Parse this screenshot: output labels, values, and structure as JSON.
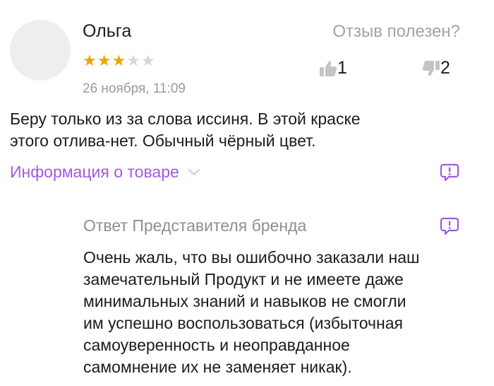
{
  "review": {
    "author": "Ольга",
    "rating": 3,
    "rating_max": 5,
    "date": "26 ноября, 11:09",
    "text_lines": [
      "Беру только из за слова иссиня. В этой краске",
      "этого отлива-нет. Обычный чёрный цвет."
    ],
    "product_info_link": "Информация о товаре"
  },
  "helpful": {
    "question": "Отзыв полезен?",
    "likes": "1",
    "dislikes": "2"
  },
  "brand_reply": {
    "title": "Ответ Представителя бренда",
    "text_lines": [
      "Очень жаль, что вы ошибочно заказали наш",
      "замечательный Продукт и не имеете даже",
      "минимальных знаний и навыков не смогли",
      "им успешно воспользоваться (избыточная",
      "самоуверенность и неоправданное",
      "самомнение их не заменяет никак)."
    ]
  },
  "icons": {
    "thumb_up": "thumbs-up-icon",
    "thumb_down": "thumbs-down-icon",
    "report": "report-icon",
    "chevron": "chevron-down-icon"
  },
  "colors": {
    "star_on": "#f4a100",
    "star_off": "#d6d6d6",
    "accent": "#a259e0",
    "muted": "#9a9a9a"
  }
}
